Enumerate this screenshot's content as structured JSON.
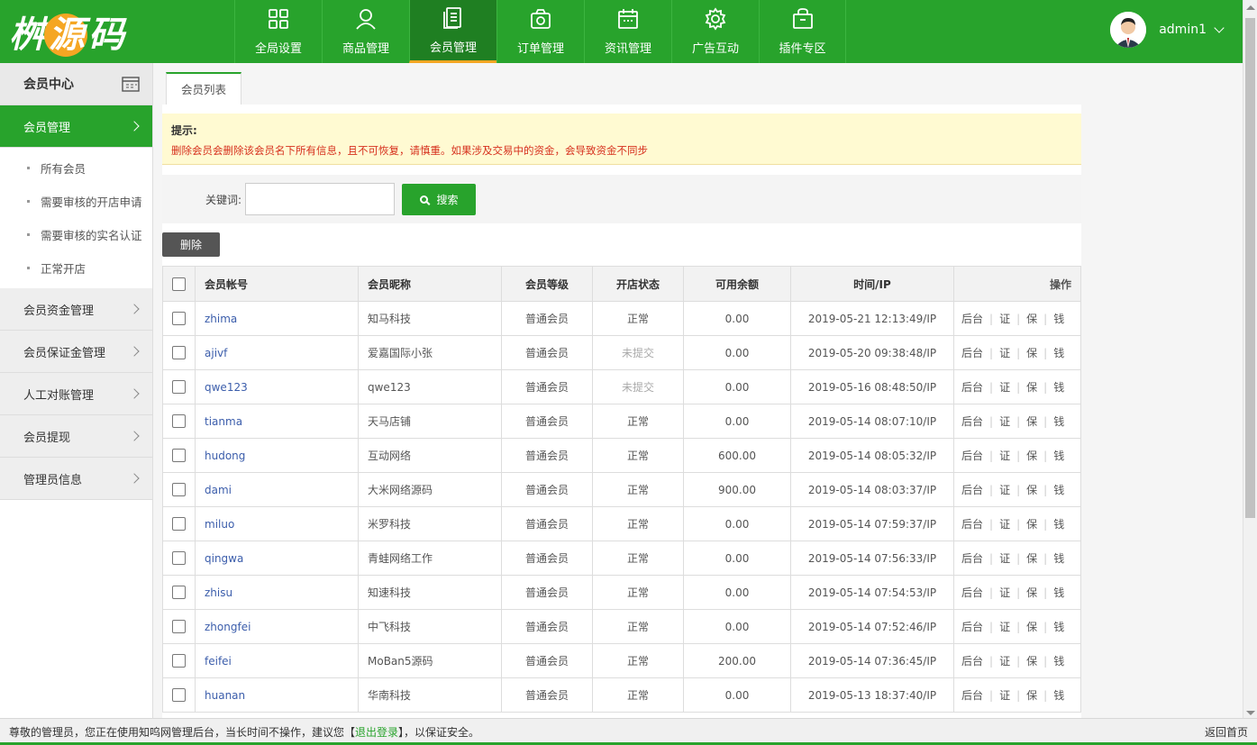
{
  "logo": {
    "part1": "桝",
    "mid": "源",
    "part2": "码"
  },
  "nav": [
    {
      "label": "全局设置",
      "icon": "grid-icon"
    },
    {
      "label": "商品管理",
      "icon": "user-icon"
    },
    {
      "label": "会员管理",
      "icon": "document-icon",
      "active": true
    },
    {
      "label": "订单管理",
      "icon": "camera-icon"
    },
    {
      "label": "资讯管理",
      "icon": "calendar-icon"
    },
    {
      "label": "广告互动",
      "icon": "gear-icon"
    },
    {
      "label": "插件专区",
      "icon": "bag-icon"
    }
  ],
  "user": {
    "name": "admin1"
  },
  "sidebar": {
    "title": "会员中心",
    "active_item": "会员管理",
    "sub_items": [
      "所有会员",
      "需要审核的开店申请",
      "需要审核的实名认证",
      "正常开店"
    ],
    "items": [
      "会员资金管理",
      "会员保证金管理",
      "人工对账管理",
      "会员提现",
      "管理员信息"
    ]
  },
  "tab": "会员列表",
  "tips": {
    "title": "提示:",
    "text": "删除会员会删除该会员名下所有信息，且不可恢复，请慎重。如果涉及交易中的资金，会导致资金不同步"
  },
  "search": {
    "label": "关键词:",
    "button": "搜索"
  },
  "delete_button": "删除",
  "table": {
    "headers": [
      "会员帐号",
      "会员昵称",
      "会员等级",
      "开店状态",
      "可用余额",
      "时间/IP",
      "操作"
    ],
    "ops": [
      "后台",
      "证",
      "保",
      "钱"
    ],
    "rows": [
      {
        "account": "zhima",
        "nick": "知马科技",
        "level": "普通会员",
        "state": "正常",
        "balance": "0.00",
        "time": "2019-05-21 12:13:49/IP"
      },
      {
        "account": "ajivf",
        "nick": "爱嘉国际小张",
        "level": "普通会员",
        "state": "未提交",
        "balance": "0.00",
        "time": "2019-05-20 09:38:48/IP"
      },
      {
        "account": "qwe123",
        "nick": "qwe123",
        "level": "普通会员",
        "state": "未提交",
        "balance": "0.00",
        "time": "2019-05-16 08:48:50/IP"
      },
      {
        "account": "tianma",
        "nick": "天马店铺",
        "level": "普通会员",
        "state": "正常",
        "balance": "0.00",
        "time": "2019-05-14 08:07:10/IP"
      },
      {
        "account": "hudong",
        "nick": "互动网络",
        "level": "普通会员",
        "state": "正常",
        "balance": "600.00",
        "time": "2019-05-14 08:05:32/IP"
      },
      {
        "account": "dami",
        "nick": "大米网络源码",
        "level": "普通会员",
        "state": "正常",
        "balance": "900.00",
        "time": "2019-05-14 08:03:37/IP"
      },
      {
        "account": "miluo",
        "nick": "米罗科技",
        "level": "普通会员",
        "state": "正常",
        "balance": "0.00",
        "time": "2019-05-14 07:59:37/IP"
      },
      {
        "account": "qingwa",
        "nick": "青蛙网络工作",
        "level": "普通会员",
        "state": "正常",
        "balance": "0.00",
        "time": "2019-05-14 07:56:33/IP"
      },
      {
        "account": "zhisu",
        "nick": "知速科技",
        "level": "普通会员",
        "state": "正常",
        "balance": "0.00",
        "time": "2019-05-14 07:54:53/IP"
      },
      {
        "account": "zhongfei",
        "nick": "中飞科技",
        "level": "普通会员",
        "state": "正常",
        "balance": "0.00",
        "time": "2019-05-14 07:52:46/IP"
      },
      {
        "account": "feifei",
        "nick": "MoBan5源码",
        "level": "普通会员",
        "state": "正常",
        "balance": "200.00",
        "time": "2019-05-14 07:36:45/IP"
      },
      {
        "account": "huanan",
        "nick": "华南科技",
        "level": "普通会员",
        "state": "正常",
        "balance": "0.00",
        "time": "2019-05-13 18:37:40/IP"
      }
    ]
  },
  "footer": {
    "text_before": "尊敬的管理员，您正在使用知呜网管理后台，当长时间不操作，建议您【",
    "logout_link": "退出登录",
    "text_after": "】，以保证安全。",
    "home_link": "返回首页"
  },
  "colors": {
    "brand_green": "#28a32c",
    "accent_orange": "#f5a623",
    "warning_red": "#d6301d"
  }
}
